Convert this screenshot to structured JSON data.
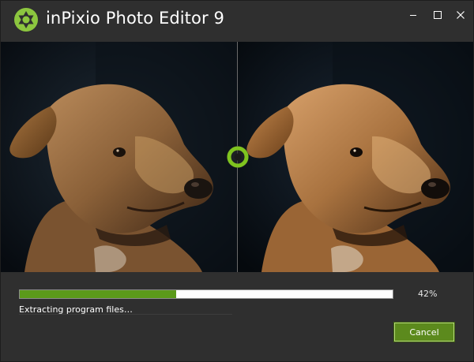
{
  "window": {
    "title": "inPixio Photo Editor 9",
    "controls": {
      "minimize_icon": "minimize-icon",
      "maximize_icon": "maximize-icon",
      "close_icon": "close-icon"
    }
  },
  "colors": {
    "background": "#2f2f2f",
    "accent": "#5b9a1a",
    "logo_green": "#8cc63f"
  },
  "preview": {
    "left_image": "dog-portrait-original",
    "right_image": "dog-portrait-enhanced",
    "handle_icon": "compare-handle-icon"
  },
  "progress": {
    "percent": 42,
    "percent_label": "42%",
    "status": "Extracting program files…"
  },
  "actions": {
    "cancel_label": "Cancel"
  }
}
